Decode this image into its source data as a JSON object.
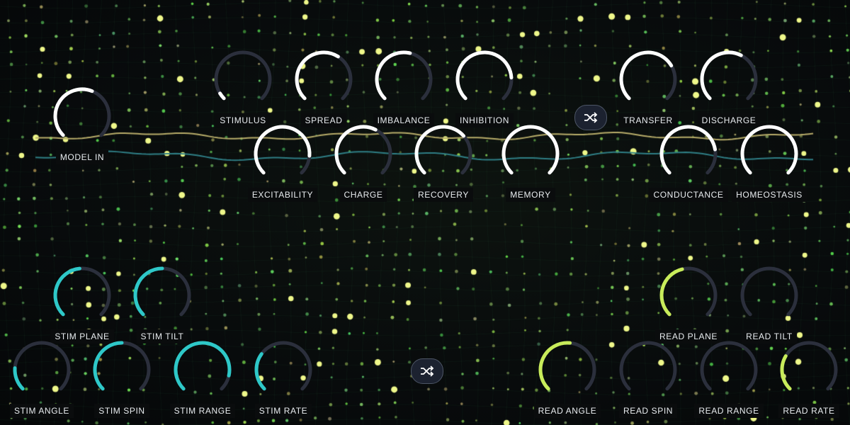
{
  "colors": {
    "track": "#2b2f3c",
    "white": "#ffffff",
    "cyan": "#2ec8c8",
    "lime": "#c8ec5a",
    "dot_green": "#7fe36a",
    "dot_yellow": "#eef78a",
    "wave_gold": "#b8ad6a",
    "wave_teal": "#2f7f86"
  },
  "knobs": [
    {
      "id": "model-in",
      "label": "MODEL IN",
      "value": 0.58,
      "color": "white"
    },
    {
      "id": "stimulus",
      "label": "STIMULUS",
      "value": 0.05,
      "color": "white"
    },
    {
      "id": "spread",
      "label": "SPREAD",
      "value": 0.62,
      "color": "white"
    },
    {
      "id": "imbalance",
      "label": "IMBALANCE",
      "value": 0.55,
      "color": "white"
    },
    {
      "id": "inhibition",
      "label": "INHIBITION",
      "value": 0.82,
      "color": "white"
    },
    {
      "id": "transfer",
      "label": "TRANSFER",
      "value": 0.72,
      "color": "white"
    },
    {
      "id": "discharge",
      "label": "DISCHARGE",
      "value": 0.6,
      "color": "white"
    },
    {
      "id": "excitability",
      "label": "EXCITABILITY",
      "value": 0.85,
      "color": "white"
    },
    {
      "id": "charge",
      "label": "CHARGE",
      "value": 0.6,
      "color": "white"
    },
    {
      "id": "recovery",
      "label": "RECOVERY",
      "value": 0.68,
      "color": "white"
    },
    {
      "id": "memory",
      "label": "MEMORY",
      "value": 1.0,
      "color": "white"
    },
    {
      "id": "conductance",
      "label": "CONDUCTANCE",
      "value": 0.8,
      "color": "white"
    },
    {
      "id": "homeostasis",
      "label": "HOMEOSTASIS",
      "value": 1.0,
      "color": "white"
    },
    {
      "id": "stim-plane",
      "label": "STIM PLANE",
      "value": 0.48,
      "color": "cyan"
    },
    {
      "id": "stim-tilt",
      "label": "STIM TILT",
      "value": 0.5,
      "color": "cyan"
    },
    {
      "id": "stim-angle",
      "label": "STIM ANGLE",
      "value": 0.18,
      "color": "cyan"
    },
    {
      "id": "stim-spin",
      "label": "STIM SPIN",
      "value": 0.5,
      "color": "cyan"
    },
    {
      "id": "stim-range",
      "label": "STIM RANGE",
      "value": 0.88,
      "color": "cyan"
    },
    {
      "id": "stim-rate",
      "label": "STIM RATE",
      "value": 0.3,
      "color": "cyan"
    },
    {
      "id": "read-plane",
      "label": "READ PLANE",
      "value": 0.45,
      "color": "lime"
    },
    {
      "id": "read-tilt",
      "label": "READ TILT",
      "value": 0.0,
      "color": "lime"
    },
    {
      "id": "read-angle",
      "label": "READ ANGLE",
      "value": 0.52,
      "color": "lime"
    },
    {
      "id": "read-spin",
      "label": "READ SPIN",
      "value": 0.0,
      "color": "lime"
    },
    {
      "id": "read-range",
      "label": "READ RANGE",
      "value": 0.0,
      "color": "lime"
    },
    {
      "id": "read-rate",
      "label": "READ RATE",
      "value": 0.28,
      "color": "lime"
    }
  ],
  "shuffle_buttons": [
    {
      "id": "top",
      "icon": "shuffle-icon"
    },
    {
      "id": "bottom",
      "icon": "shuffle-icon"
    }
  ]
}
